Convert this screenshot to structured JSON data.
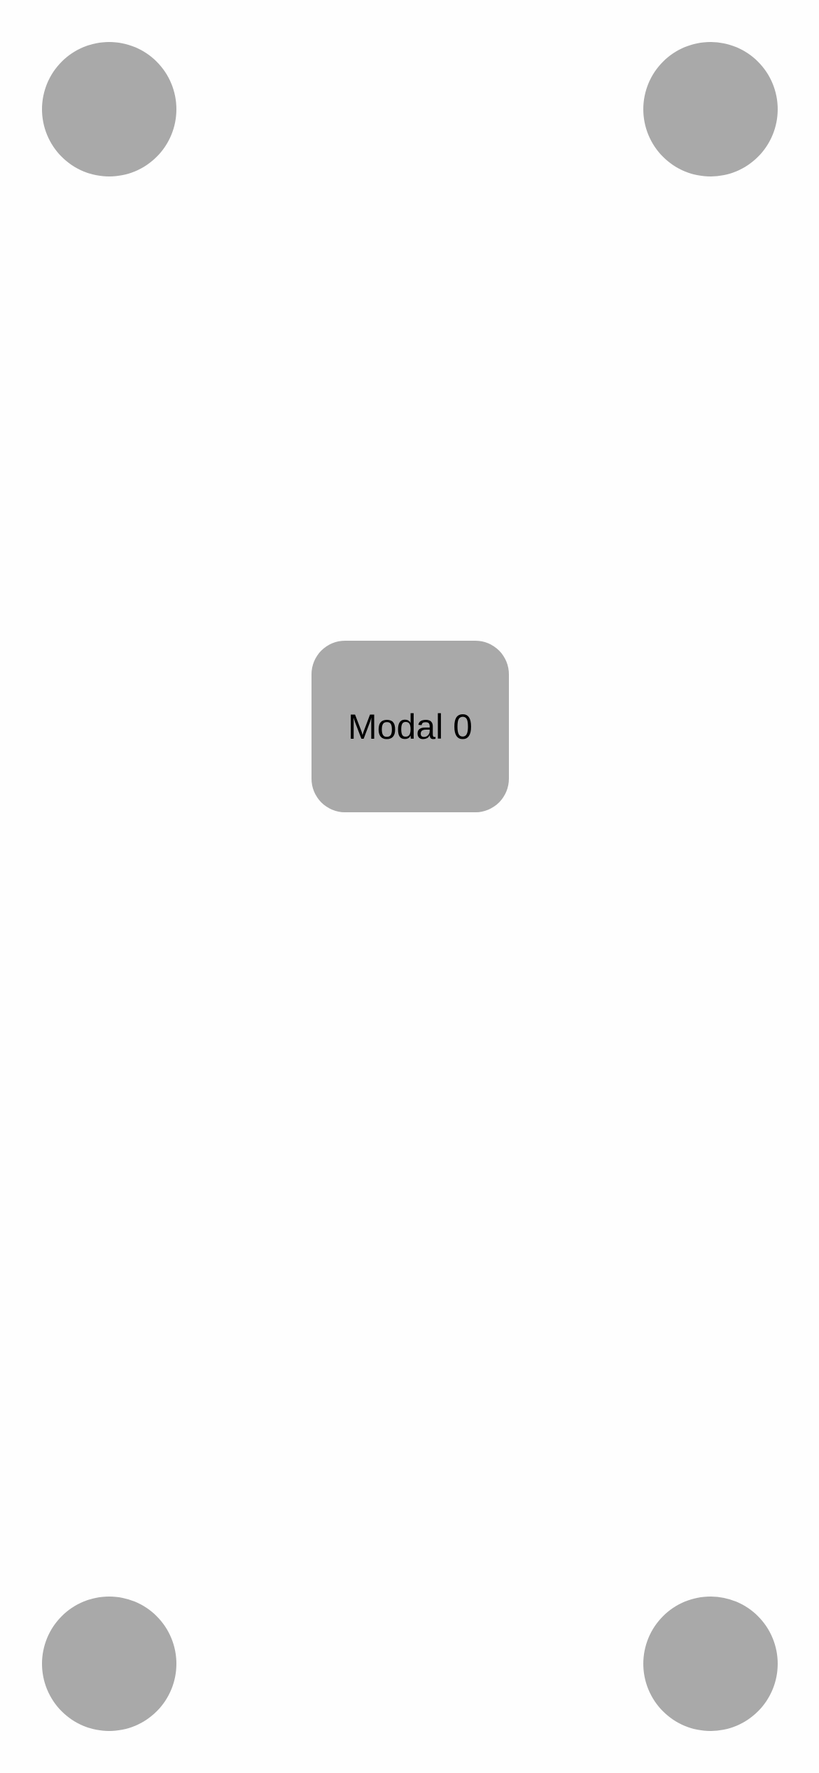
{
  "modal": {
    "label": "Modal 0"
  },
  "corner_buttons": {
    "top_left": "circle-button",
    "top_right": "circle-button",
    "bottom_left": "circle-button",
    "bottom_right": "circle-button"
  },
  "colors": {
    "background": "#fefefe",
    "control_fill": "#a9a9a9",
    "text": "#000000"
  }
}
